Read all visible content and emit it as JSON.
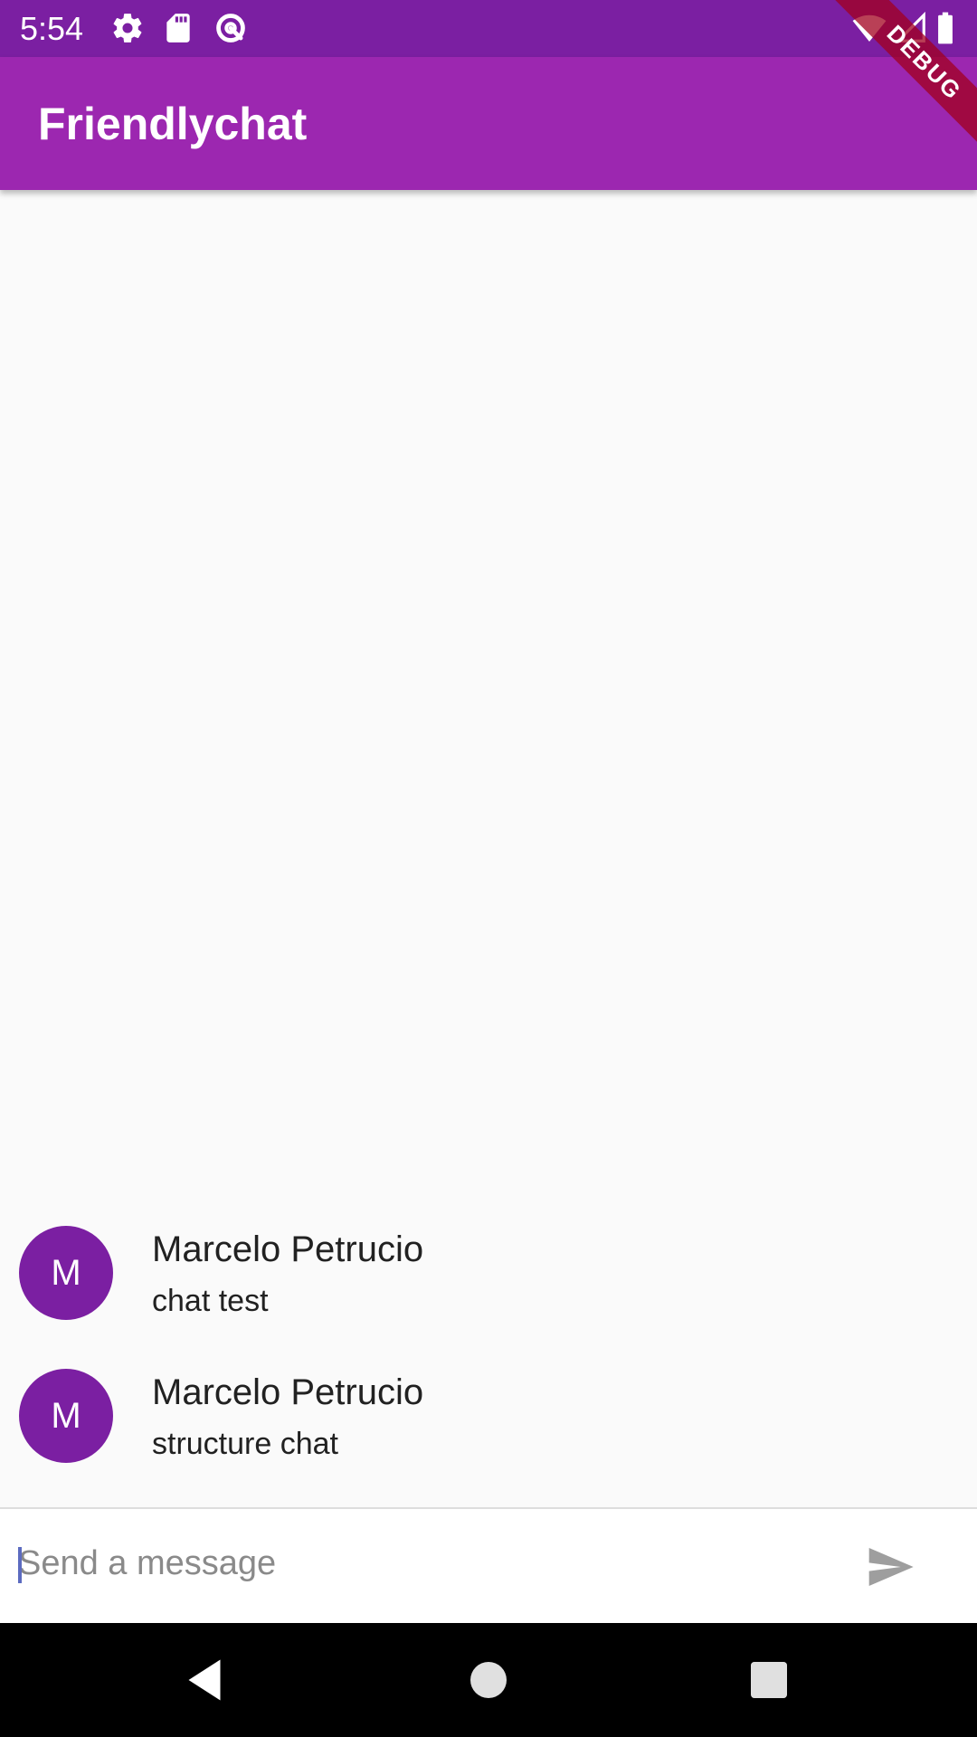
{
  "status_bar": {
    "time": "5:54",
    "left_icons": [
      "gear-icon",
      "sd-card-icon",
      "data-saver-icon"
    ],
    "right_icons": [
      "wifi-icon",
      "cell-signal-icon",
      "battery-icon"
    ],
    "background_color": "#7b1fa2"
  },
  "app_bar": {
    "title": "Friendlychat",
    "background_color": "#9c27b0"
  },
  "debug_banner": {
    "label": "DEBUG"
  },
  "messages": [
    {
      "avatar_initial": "M",
      "sender": "Marcelo Petrucio",
      "text": "chat test"
    },
    {
      "avatar_initial": "M",
      "sender": "Marcelo Petrucio",
      "text": "structure chat"
    }
  ],
  "composer": {
    "placeholder": "Send a message",
    "value": "",
    "send_icon": "send-icon"
  },
  "nav_bar": {
    "buttons": [
      "back-icon",
      "home-icon",
      "recents-icon"
    ]
  },
  "colors": {
    "avatar": "#7b1fa2",
    "background": "#fafafa"
  }
}
